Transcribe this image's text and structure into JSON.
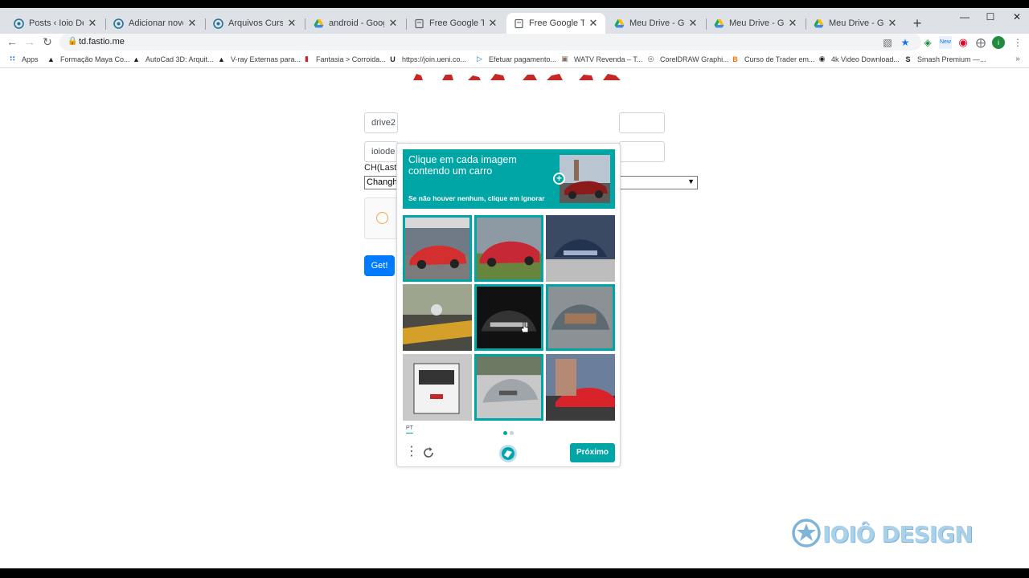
{
  "browser": {
    "tabs": [
      {
        "title": "Posts ‹ Ioio Design —",
        "icon": "wordpress-icon",
        "active": false
      },
      {
        "title": "Adicionar novo post",
        "icon": "wordpress-icon",
        "active": false
      },
      {
        "title": "Arquivos Curso - Ioio",
        "icon": "wordpress-icon",
        "active": false
      },
      {
        "title": "android - Google Driv",
        "icon": "google-drive-icon",
        "active": false
      },
      {
        "title": "Free Google TeamDriv",
        "icon": "page-icon",
        "active": false
      },
      {
        "title": "Free Google TeamDriv",
        "icon": "page-icon",
        "active": true
      },
      {
        "title": "Meu Drive - Google D",
        "icon": "google-drive-icon",
        "active": false
      },
      {
        "title": "Meu Drive - Google D",
        "icon": "google-drive-icon",
        "active": false
      },
      {
        "title": "Meu Drive - Google D",
        "icon": "google-drive-icon",
        "active": false
      }
    ],
    "close_glyph": "✕",
    "new_tab_glyph": "+",
    "window_controls": {
      "minimize": "—",
      "maximize": "☐",
      "close": "✕"
    },
    "url": "td.fastio.me",
    "bookmarks": [
      {
        "label": "Apps",
        "icon": "apps-grid-icon"
      },
      {
        "label": "Formação Maya Co...",
        "icon": "graduation-cap-icon"
      },
      {
        "label": "AutoCad 3D: Arquit...",
        "icon": "graduation-cap-icon"
      },
      {
        "label": "V-ray Externas para...",
        "icon": "graduation-cap-icon"
      },
      {
        "label": "Fantasia > Corroida...",
        "icon": "bookmark-red-icon"
      },
      {
        "label": "https://join.ueni.co...",
        "icon": "ueni-icon"
      },
      {
        "label": "Efetuar pagamento...",
        "icon": "play-icon"
      },
      {
        "label": "WATV Revenda – T...",
        "icon": "tv-icon"
      },
      {
        "label": "CorelDRAW Graphi...",
        "icon": "corel-icon"
      },
      {
        "label": "Curso de Trader em...",
        "icon": "blogger-icon"
      },
      {
        "label": "4k Video Download...",
        "icon": "globe-icon"
      },
      {
        "label": "Smash Premium —...",
        "icon": "smash-icon"
      }
    ]
  },
  "page": {
    "field_drive": "drive2",
    "field_email": "ioiode",
    "ch_label": "CH(Last",
    "ch_select_value": "Changh",
    "get_button": "Get!"
  },
  "captcha": {
    "prompt": "Clique em cada imagem contendo um carro",
    "hint": "Se não houver nenhum, clique em Ignorar",
    "language": "PT",
    "next_button": "Próximo",
    "accent": "#00a6a6",
    "cells": [
      {
        "scene": "red sports car at show",
        "selected": true
      },
      {
        "scene": "red classic corvette",
        "selected": true
      },
      {
        "scene": "blue car front at night",
        "selected": false
      },
      {
        "scene": "man working on vehicle",
        "selected": false
      },
      {
        "scene": "dark car front at night",
        "selected": true
      },
      {
        "scene": "car with open hood",
        "selected": true
      },
      {
        "scene": "bus front",
        "selected": false
      },
      {
        "scene": "silver car rear",
        "selected": true
      },
      {
        "scene": "red car with person",
        "selected": false
      }
    ]
  },
  "watermark": {
    "text": "IOIÔ DESIGN"
  }
}
